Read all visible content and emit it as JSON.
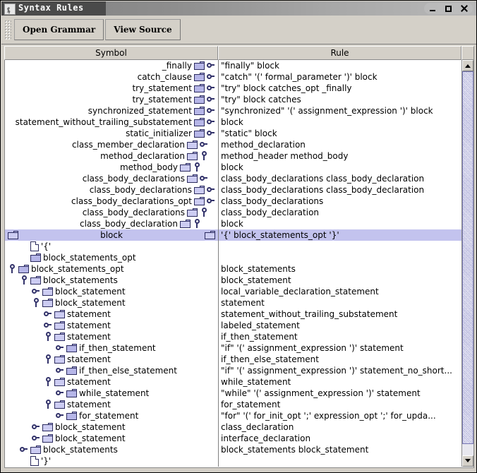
{
  "window": {
    "title": "Syntax Rules",
    "icon": "java-duke-icon",
    "controls": {
      "minimize": "minimize",
      "maximize": "maximize",
      "close": "close"
    }
  },
  "toolbar": {
    "grip": "toolbar-grip",
    "buttons": [
      {
        "label": "Open Grammar",
        "name": "open-grammar-button"
      },
      {
        "label": "View Source",
        "name": "view-source-button"
      }
    ]
  },
  "table": {
    "columns": [
      {
        "label": "Symbol",
        "name": "column-header-symbol"
      },
      {
        "label": "Rule",
        "name": "column-header-rule"
      }
    ]
  },
  "colors": {
    "selection": "#c3c3ee",
    "folder": "#b6b6e8",
    "folder_border": "#2b2b5e",
    "handle": "#33336b",
    "panel_bg": "#d4d0c8",
    "scrollbar_thumb": "#9f9fd2"
  },
  "scrollbar": {
    "up_label": "scroll-up",
    "down_label": "scroll-down",
    "thumb_label": "scroll-thumb"
  },
  "rows": [
    {
      "align": "right",
      "depth": 0,
      "icon": "folder",
      "handle": "collapsed-right",
      "symbol": "_finally",
      "rule": "\"finally\"   block",
      "selected": false
    },
    {
      "align": "right",
      "depth": 0,
      "icon": "folder",
      "handle": "collapsed-right",
      "symbol": "catch_clause",
      "rule": "\"catch\"   '('   formal_parameter   ')'   block",
      "selected": false
    },
    {
      "align": "right",
      "depth": 0,
      "icon": "folder",
      "handle": "collapsed-right",
      "symbol": "try_statement",
      "rule": "\"try\"   block   catches_opt   _finally",
      "selected": false
    },
    {
      "align": "right",
      "depth": 0,
      "icon": "folder",
      "handle": "collapsed-right",
      "symbol": "try_statement",
      "rule": "\"try\"   block   catches",
      "selected": false
    },
    {
      "align": "right",
      "depth": 0,
      "icon": "folder",
      "handle": "collapsed-right",
      "symbol": "synchronized_statement",
      "rule": "\"synchronized\"   '('   assignment_expression   ')'   block",
      "selected": false
    },
    {
      "align": "right",
      "depth": 0,
      "icon": "folder",
      "handle": "collapsed-right",
      "symbol": "statement_without_trailing_substatement",
      "rule": "block",
      "selected": false
    },
    {
      "align": "right",
      "depth": 0,
      "icon": "folder",
      "handle": "collapsed-right",
      "symbol": "static_initializer",
      "rule": "\"static\"   block",
      "selected": false
    },
    {
      "align": "right",
      "depth": 1,
      "icon": "folder-open",
      "handle": "collapsed-right",
      "symbol": "class_member_declaration",
      "rule": "method_declaration",
      "selected": false
    },
    {
      "align": "right",
      "depth": 1,
      "icon": "folder-open",
      "handle": "expanded-down",
      "symbol": "method_declaration",
      "rule": "method_header   method_body",
      "selected": false
    },
    {
      "align": "right",
      "depth": 2,
      "icon": "folder-open",
      "handle": "expanded-down",
      "symbol": "method_body",
      "rule": "block",
      "selected": false
    },
    {
      "align": "right",
      "depth": 1,
      "icon": "folder-open",
      "handle": "collapsed-right",
      "symbol": "class_body_declarations",
      "rule": "class_body_declarations   class_body_declaration",
      "selected": false
    },
    {
      "align": "right",
      "depth": 0,
      "icon": "folder-open",
      "handle": "collapsed-right",
      "symbol": "class_body_declarations",
      "rule": "class_body_declarations   class_body_declaration",
      "selected": false
    },
    {
      "align": "right",
      "depth": 0,
      "icon": "folder-open",
      "handle": "collapsed-right",
      "symbol": "class_body_declarations_opt",
      "rule": "class_body_declarations",
      "selected": false
    },
    {
      "align": "right",
      "depth": 1,
      "icon": "folder-open",
      "handle": "expanded-down",
      "symbol": "class_body_declarations",
      "rule": "class_body_declaration",
      "selected": false
    },
    {
      "align": "right",
      "depth": 2,
      "icon": "folder-open",
      "handle": "expanded-down",
      "symbol": "class_body_declaration",
      "rule": "block",
      "selected": false
    },
    {
      "align": "both",
      "depth": 0,
      "icon": "folder-open",
      "handle": "none",
      "symbol": "block",
      "rule": "'{'   block_statements_opt   '}'",
      "selected": true
    },
    {
      "align": "left",
      "depth": 1,
      "icon": "leaf",
      "handle": "none",
      "symbol": "'{'",
      "rule": "",
      "selected": false
    },
    {
      "align": "left",
      "depth": 1,
      "icon": "folder",
      "handle": "none",
      "symbol": "block_statements_opt",
      "rule": "",
      "selected": false
    },
    {
      "align": "left",
      "depth": 0,
      "icon": "folder",
      "handle": "expanded-down",
      "symbol": "block_statements_opt",
      "rule": "block_statements",
      "selected": false
    },
    {
      "align": "left",
      "depth": 1,
      "icon": "folder-open",
      "handle": "expanded-down",
      "symbol": "block_statements",
      "rule": "block_statement",
      "selected": false
    },
    {
      "align": "left",
      "depth": 2,
      "icon": "folder-open",
      "handle": "collapsed-right",
      "symbol": "block_statement",
      "rule": "local_variable_declaration_statement",
      "selected": false
    },
    {
      "align": "left",
      "depth": 2,
      "icon": "folder-open",
      "handle": "expanded-down",
      "symbol": "block_statement",
      "rule": "statement",
      "selected": false
    },
    {
      "align": "left",
      "depth": 3,
      "icon": "folder-open",
      "handle": "collapsed-right",
      "symbol": "statement",
      "rule": "statement_without_trailing_substatement",
      "selected": false
    },
    {
      "align": "left",
      "depth": 3,
      "icon": "folder-open",
      "handle": "collapsed-right",
      "symbol": "statement",
      "rule": "labeled_statement",
      "selected": false
    },
    {
      "align": "left",
      "depth": 3,
      "icon": "folder-open",
      "handle": "expanded-down",
      "symbol": "statement",
      "rule": "if_then_statement",
      "selected": false
    },
    {
      "align": "left",
      "depth": 4,
      "icon": "folder",
      "handle": "collapsed-right",
      "symbol": "if_then_statement",
      "rule": "\"if\"   '('   assignment_expression   ')'   statement",
      "selected": false
    },
    {
      "align": "left",
      "depth": 3,
      "icon": "folder-open",
      "handle": "expanded-down",
      "symbol": "statement",
      "rule": "if_then_else_statement",
      "selected": false
    },
    {
      "align": "left",
      "depth": 4,
      "icon": "folder",
      "handle": "collapsed-right",
      "symbol": "if_then_else_statement",
      "rule": "\"if\"   '('   assignment_expression   ')'   statement_no_short...",
      "selected": false
    },
    {
      "align": "left",
      "depth": 3,
      "icon": "folder-open",
      "handle": "expanded-down",
      "symbol": "statement",
      "rule": "while_statement",
      "selected": false
    },
    {
      "align": "left",
      "depth": 4,
      "icon": "folder",
      "handle": "collapsed-right",
      "symbol": "while_statement",
      "rule": "\"while\"   '('   assignment_expression   ')'   statement",
      "selected": false
    },
    {
      "align": "left",
      "depth": 3,
      "icon": "folder-open",
      "handle": "expanded-down",
      "symbol": "statement",
      "rule": "for_statement",
      "selected": false
    },
    {
      "align": "left",
      "depth": 4,
      "icon": "folder",
      "handle": "collapsed-right",
      "symbol": "for_statement",
      "rule": "\"for\"   '('   for_init_opt   ';'   expression_opt   ';'   for_upda...",
      "selected": false
    },
    {
      "align": "left",
      "depth": 2,
      "icon": "folder-open",
      "handle": "collapsed-right",
      "symbol": "block_statement",
      "rule": "class_declaration",
      "selected": false
    },
    {
      "align": "left",
      "depth": 2,
      "icon": "folder-open",
      "handle": "collapsed-right",
      "symbol": "block_statement",
      "rule": "interface_declaration",
      "selected": false
    },
    {
      "align": "left",
      "depth": 1,
      "icon": "folder-open",
      "handle": "collapsed-right",
      "symbol": "block_statements",
      "rule": "block_statements   block_statement",
      "selected": false
    },
    {
      "align": "left",
      "depth": 1,
      "icon": "leaf",
      "handle": "none",
      "symbol": "'}'",
      "rule": "",
      "selected": false
    }
  ]
}
